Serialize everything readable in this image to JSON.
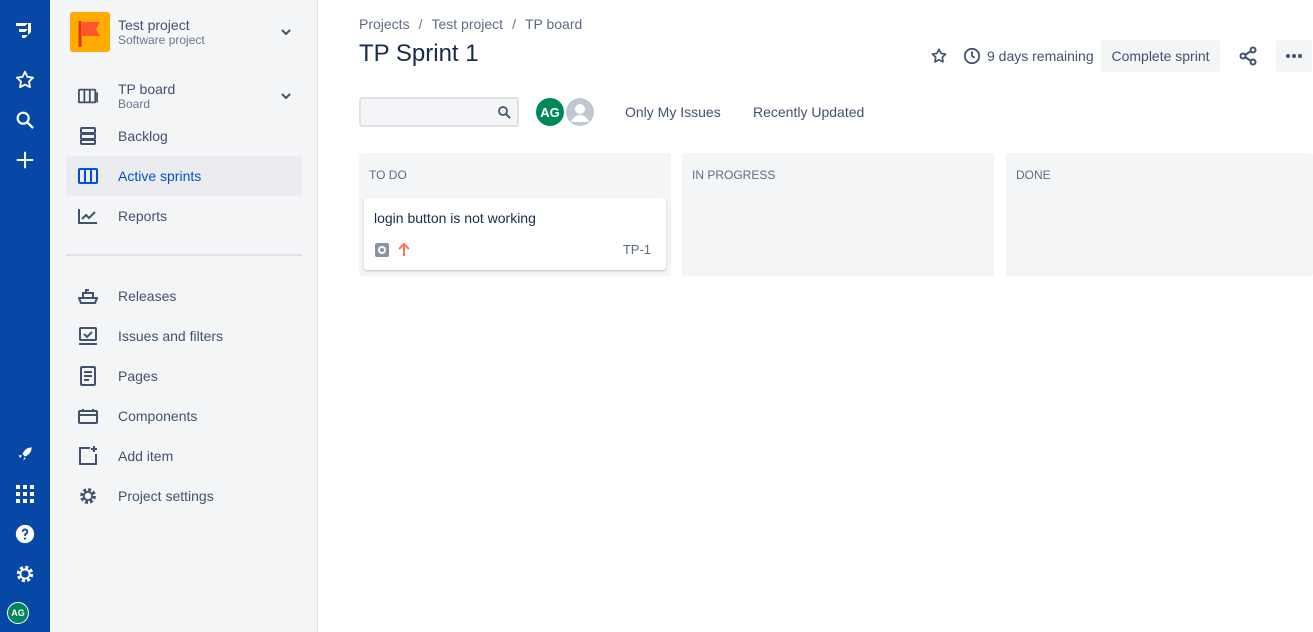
{
  "colors": {
    "global_nav_bg": "#0747A6",
    "sidebar_bg": "#F4F5F7",
    "active_text": "#0052CC",
    "avatar_green": "#00875A",
    "priority_orange": "#FF7452",
    "project_avatar": "#FFAB00"
  },
  "global_nav": {
    "icons": [
      "jira-logo-icon",
      "star-icon",
      "search-icon",
      "plus-icon",
      "rocket-icon",
      "app-switcher-icon",
      "help-icon",
      "settings-icon"
    ],
    "avatar_initials": "AG"
  },
  "sidebar": {
    "project_name": "Test project",
    "project_type": "Software project",
    "board_name": "TP board",
    "board_sub": "Board",
    "items": [
      {
        "label": "Backlog",
        "icon": "backlog-icon"
      },
      {
        "label": "Active sprints",
        "icon": "board-columns-icon",
        "active": true
      },
      {
        "label": "Reports",
        "icon": "reports-chart-icon"
      },
      {
        "label": "Releases",
        "icon": "ship-icon"
      },
      {
        "label": "Issues and filters",
        "icon": "issues-filter-icon"
      },
      {
        "label": "Pages",
        "icon": "page-icon"
      },
      {
        "label": "Components",
        "icon": "component-icon"
      },
      {
        "label": "Add item",
        "icon": "add-item-icon"
      },
      {
        "label": "Project settings",
        "icon": "gear-icon"
      }
    ]
  },
  "header": {
    "breadcrumbs": [
      "Projects",
      "Test project",
      "TP board"
    ],
    "title": "TP Sprint 1",
    "remaining": "9 days remaining",
    "complete_button": "Complete sprint"
  },
  "filters": {
    "search_placeholder": "",
    "avatar_initials": "AG",
    "quick_filters": [
      "Only My Issues",
      "Recently Updated"
    ]
  },
  "board": {
    "columns": [
      {
        "title": "TO DO"
      },
      {
        "title": "IN PROGRESS"
      },
      {
        "title": "DONE"
      }
    ],
    "cards": [
      {
        "summary": "login button is not working",
        "key": "TP-1",
        "type_icon": "task-icon",
        "priority_icon": "priority-high-arrow-icon"
      }
    ]
  }
}
